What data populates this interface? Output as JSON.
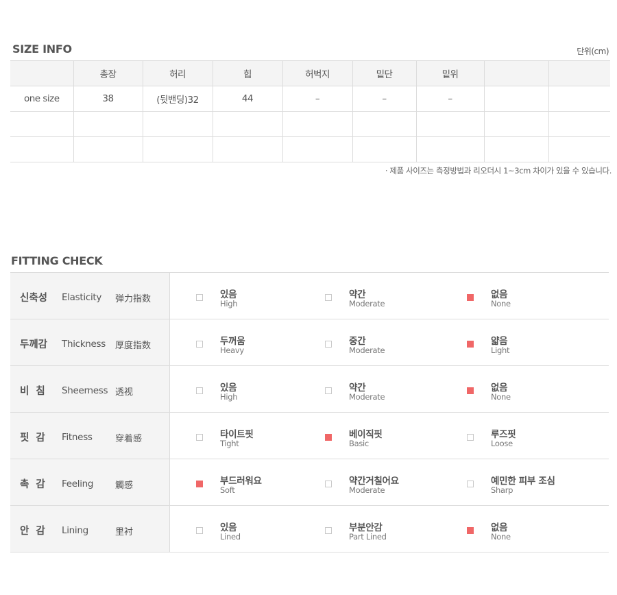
{
  "size_info": {
    "title": "SIZE INFO",
    "unit": "단위(cm)",
    "headers": [
      "",
      "총장",
      "허리",
      "힙",
      "허벅지",
      "밑단",
      "밑위",
      "",
      ""
    ],
    "rows": [
      [
        "one size",
        "38",
        "(뒷밴딩)32",
        "44",
        "–",
        "–",
        "–",
        "",
        ""
      ],
      [
        "",
        "",
        "",
        "",
        "",
        "",
        "",
        "",
        ""
      ],
      [
        "",
        "",
        "",
        "",
        "",
        "",
        "",
        "",
        ""
      ]
    ],
    "note": "· 제품 사이즈는 측정방법과 리오더시 1~3cm 차이가 있을 수 있습니다."
  },
  "fitting_check": {
    "title": "FITTING CHECK",
    "selected_color": "#f06767",
    "rows": [
      {
        "ko": "신축성",
        "en": "Elasticity",
        "cn": "弹力指数",
        "selected": 2,
        "options": [
          {
            "ko": "있음",
            "en": "High"
          },
          {
            "ko": "약간",
            "en": "Moderate"
          },
          {
            "ko": "없음",
            "en": "None"
          }
        ]
      },
      {
        "ko": "두께감",
        "en": "Thickness",
        "cn": "厚度指数",
        "selected": 2,
        "options": [
          {
            "ko": "두꺼움",
            "en": "Heavy"
          },
          {
            "ko": "중간",
            "en": "Moderate"
          },
          {
            "ko": "얇음",
            "en": "Light"
          }
        ]
      },
      {
        "ko": "비  침",
        "en": "Sheerness",
        "cn": "透视",
        "selected": 2,
        "options": [
          {
            "ko": "있음",
            "en": "High"
          },
          {
            "ko": "약간",
            "en": "Moderate"
          },
          {
            "ko": "없음",
            "en": "None"
          }
        ]
      },
      {
        "ko": "핏  감",
        "en": "Fitness",
        "cn": "穿着感",
        "selected": 1,
        "options": [
          {
            "ko": "타이트핏",
            "en": "Tight"
          },
          {
            "ko": "베이직핏",
            "en": "Basic"
          },
          {
            "ko": "루즈핏",
            "en": "Loose"
          }
        ]
      },
      {
        "ko": "촉  감",
        "en": "Feeling",
        "cn": "觸感",
        "selected": 0,
        "options": [
          {
            "ko": "부드러워요",
            "en": "Soft"
          },
          {
            "ko": "약간거칠어요",
            "en": "Moderate"
          },
          {
            "ko": "예민한 피부 조심",
            "en": "Sharp"
          }
        ]
      },
      {
        "ko": "안  감",
        "en": "Lining",
        "cn": "里衬",
        "selected": 2,
        "options": [
          {
            "ko": "있음",
            "en": "Lined"
          },
          {
            "ko": "부분안감",
            "en": "Part Lined"
          },
          {
            "ko": "없음",
            "en": "None"
          }
        ]
      }
    ]
  }
}
